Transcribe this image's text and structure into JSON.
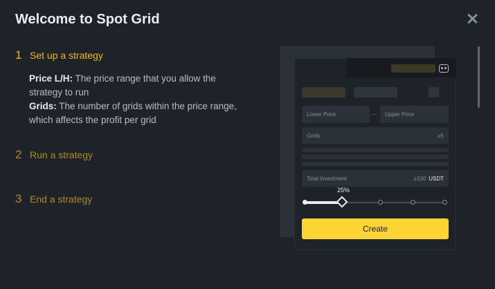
{
  "dialog": {
    "title": "Welcome to Spot Grid"
  },
  "steps": [
    {
      "number": "1",
      "label": "Set up a strategy",
      "active": true
    },
    {
      "number": "2",
      "label": "Run a strategy",
      "active": false
    },
    {
      "number": "3",
      "label": "End a strategy",
      "active": false
    }
  ],
  "description": {
    "price_term": "Price L/H:",
    "price_text": "The price range that you allow the strategy to run",
    "grids_term": "Grids:",
    "grids_text": "The number of grids within the price range, which affects the profit per grid"
  },
  "form": {
    "lower_price_placeholder": "Lower Price",
    "upper_price_placeholder": "Upper Price",
    "grids_placeholder": "Grids",
    "grids_hint": "≥5",
    "investment_placeholder": "Total investment",
    "investment_hint": "≥100",
    "investment_unit": "USDT",
    "slider_percent_label": "25%",
    "slider_value": 0.25,
    "create_label": "Create"
  },
  "colors": {
    "accent": "#f0b90b",
    "button": "#fcd535",
    "background": "#1e2329"
  },
  "icons": {
    "close": "close-icon",
    "robot": "robot-icon"
  }
}
